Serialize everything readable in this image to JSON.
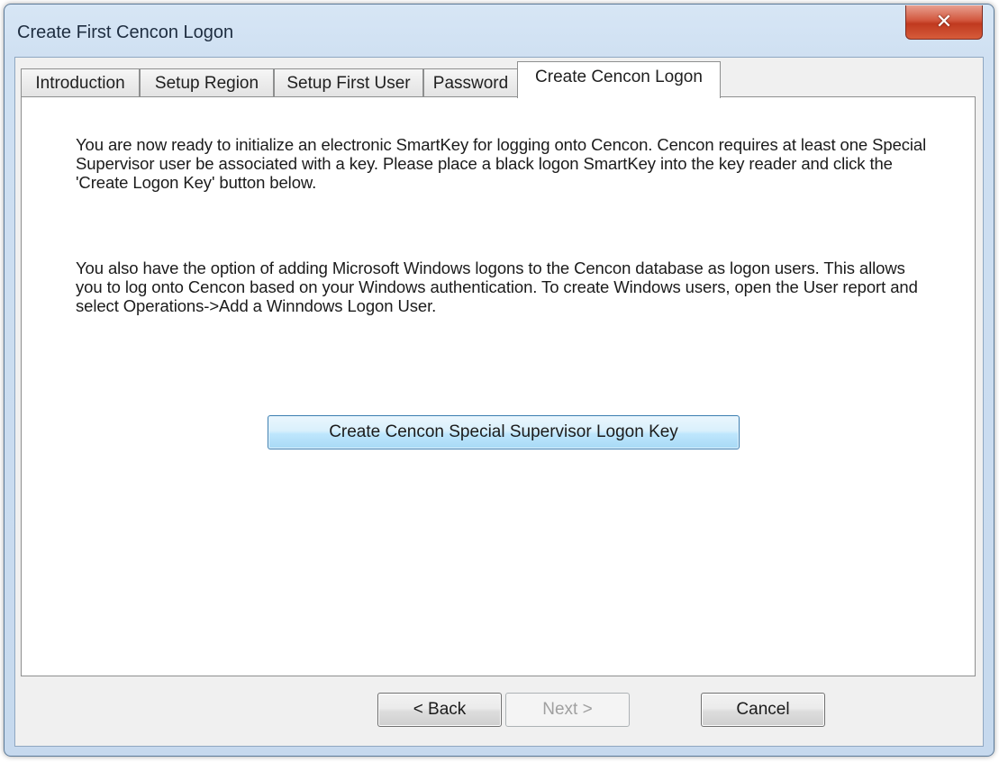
{
  "window": {
    "title": "Create First Cencon Logon",
    "close_glyph": "✕"
  },
  "tabs": [
    {
      "label": "Introduction",
      "active": false
    },
    {
      "label": "Setup Region",
      "active": false
    },
    {
      "label": "Setup First User",
      "active": false
    },
    {
      "label": "Password",
      "active": false
    },
    {
      "label": "Create Cencon Logon",
      "active": true
    }
  ],
  "panel": {
    "paragraph1": "You are now ready to initialize an electronic SmartKey for logging onto Cencon. Cencon requires at least one Special Supervisor user be associated with a key.  Please place a black logon SmartKey into the key reader and click the 'Create Logon Key' button below.",
    "paragraph2": "You also have the option of adding Microsoft Windows logons to the Cencon database as logon users.  This allows you to log onto Cencon based on your Windows authentication.  To create Windows users, open the User report and select Operations->Add a Winndows Logon User.",
    "create_key_button": "Create Cencon Special Supervisor Logon Key"
  },
  "buttons": {
    "back": "< Back",
    "next": "Next >",
    "cancel": "Cancel"
  },
  "colors": {
    "frame": "#cfe0f2",
    "close_button": "#c0391f",
    "focused_button_border": "#3c7fb1"
  }
}
